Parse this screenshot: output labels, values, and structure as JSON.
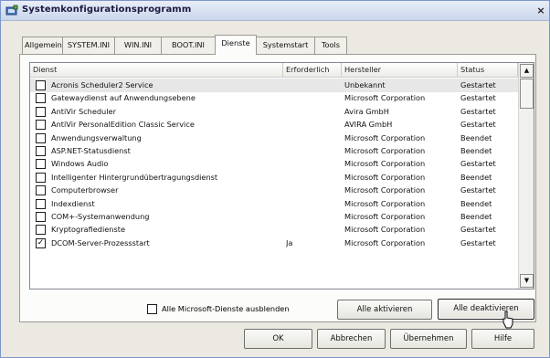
{
  "window": {
    "title": "Systemkonfigurationsprogramm",
    "close_label": "×"
  },
  "tabs": [
    {
      "label": "Allgemein"
    },
    {
      "label": "SYSTEM.INI"
    },
    {
      "label": "WIN.INI"
    },
    {
      "label": "BOOT.INI"
    },
    {
      "label": "Dienste",
      "active": true
    },
    {
      "label": "Systemstart"
    },
    {
      "label": "Tools"
    }
  ],
  "table": {
    "columns": [
      "Dienst",
      "Erforderlich",
      "Hersteller",
      "Status"
    ],
    "rows": [
      {
        "checked": false,
        "dienst": "Acronis Scheduler2 Service",
        "erforderlich": "",
        "hersteller": "Unbekannt",
        "status": "Gestartet",
        "selected": true
      },
      {
        "checked": false,
        "dienst": "Gatewaydienst auf Anwendungsebene",
        "erforderlich": "",
        "hersteller": "Microsoft Corporation",
        "status": "Gestartet"
      },
      {
        "checked": false,
        "dienst": "AntiVir Scheduler",
        "erforderlich": "",
        "hersteller": "Avira GmbH",
        "status": "Gestartet"
      },
      {
        "checked": false,
        "dienst": "AntiVir PersonalEdition Classic Service",
        "erforderlich": "",
        "hersteller": "AVIRA GmbH",
        "status": "Gestartet"
      },
      {
        "checked": false,
        "dienst": "Anwendungsverwaltung",
        "erforderlich": "",
        "hersteller": "Microsoft Corporation",
        "status": "Beendet"
      },
      {
        "checked": false,
        "dienst": "ASP.NET-Statusdienst",
        "erforderlich": "",
        "hersteller": "Microsoft Corporation",
        "status": "Beendet"
      },
      {
        "checked": false,
        "dienst": "Windows Audio",
        "erforderlich": "",
        "hersteller": "Microsoft Corporation",
        "status": "Gestartet"
      },
      {
        "checked": false,
        "dienst": "Intelligenter Hintergrundübertragungsdienst",
        "erforderlich": "",
        "hersteller": "Microsoft Corporation",
        "status": "Beendet"
      },
      {
        "checked": false,
        "dienst": "Computerbrowser",
        "erforderlich": "",
        "hersteller": "Microsoft Corporation",
        "status": "Gestartet"
      },
      {
        "checked": false,
        "dienst": "Indexdienst",
        "erforderlich": "",
        "hersteller": "Microsoft Corporation",
        "status": "Beendet"
      },
      {
        "checked": false,
        "dienst": "COM+-Systemanwendung",
        "erforderlich": "",
        "hersteller": "Microsoft Corporation",
        "status": "Beendet"
      },
      {
        "checked": false,
        "dienst": "Kryptografiedienste",
        "erforderlich": "",
        "hersteller": "Microsoft Corporation",
        "status": "Gestartet"
      },
      {
        "checked": true,
        "dienst": "DCOM-Server-Prozessstart",
        "erforderlich": "Ja",
        "hersteller": "Microsoft Corporation",
        "status": "Gestartet"
      }
    ]
  },
  "hide_ms": {
    "label": "Alle Microsoft-Dienste ausblenden",
    "checked": false
  },
  "buttons": {
    "enable_all": "Alle aktivieren",
    "disable_all": "Alle deaktivieren",
    "ok": "OK",
    "cancel": "Abbrechen",
    "apply": "Übernehmen",
    "help": "Hilfe"
  },
  "scrollbar": {
    "up": "▲",
    "down": "▼"
  }
}
